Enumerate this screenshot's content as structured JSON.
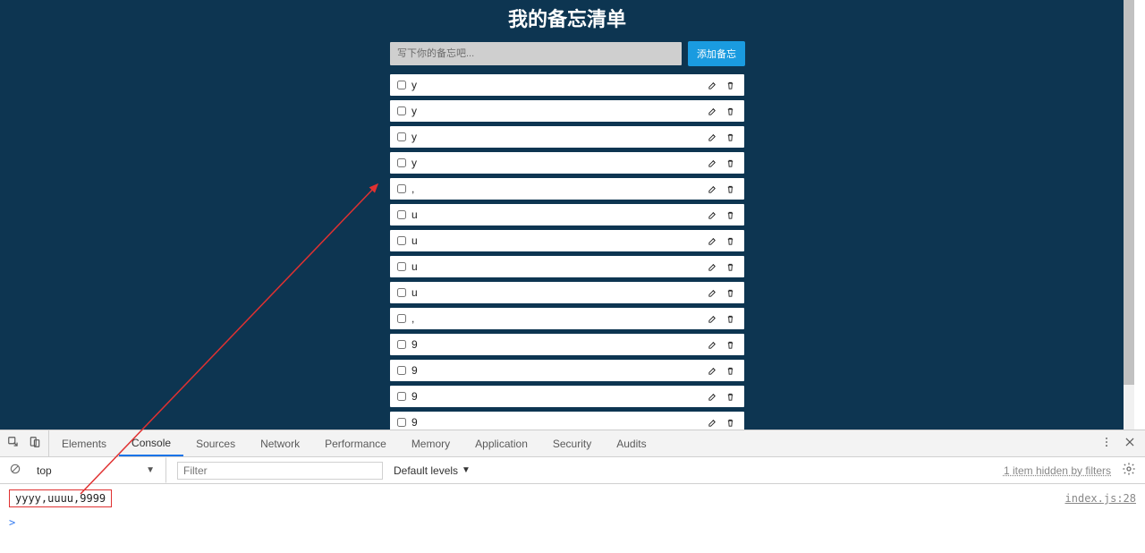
{
  "header": {
    "title": "我的备忘清单"
  },
  "input": {
    "placeholder": "写下你的备忘吧...",
    "add_label": "添加备忘"
  },
  "todos": [
    "y",
    "y",
    "y",
    "y",
    ",",
    "u",
    "u",
    "u",
    "u",
    ",",
    "9",
    "9",
    "9",
    "9"
  ],
  "devtools": {
    "tabs": [
      "Elements",
      "Console",
      "Sources",
      "Network",
      "Performance",
      "Memory",
      "Application",
      "Security",
      "Audits"
    ],
    "active_tab": "Console",
    "context": "top",
    "filter_placeholder": "Filter",
    "levels_label": "Default levels",
    "hidden_msg": "1 item hidden by filters",
    "log_text": "yyyy,uuuu,9999",
    "log_source": "index.js:28",
    "prompt": ">"
  }
}
